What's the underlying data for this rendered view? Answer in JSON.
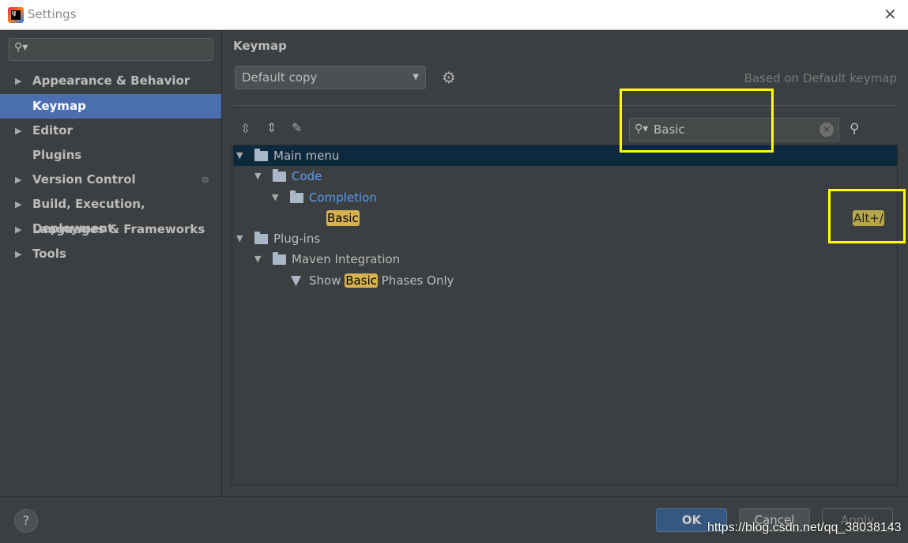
{
  "window": {
    "title": "Settings",
    "close": "✕"
  },
  "sidebar": {
    "search_placeholder": "",
    "items": [
      {
        "label": "Appearance & Behavior",
        "expandable": true
      },
      {
        "label": "Keymap",
        "selected": true
      },
      {
        "label": "Editor",
        "expandable": true
      },
      {
        "label": "Plugins"
      },
      {
        "label": "Version Control",
        "expandable": true
      },
      {
        "label": "Build, Execution, Deployment",
        "expandable": true
      },
      {
        "label": "Languages & Frameworks",
        "expandable": true
      },
      {
        "label": "Tools",
        "expandable": true
      }
    ]
  },
  "main": {
    "title": "Keymap",
    "keymap_select": "Default copy",
    "based_on": "Based on Default keymap",
    "search_value": "Basic",
    "tree": {
      "main_menu": "Main menu",
      "code": "Code",
      "completion": "Completion",
      "basic": "Basic",
      "shortcut": "Alt+/",
      "plugins": "Plug-ins",
      "maven": "Maven Integration",
      "show": "Show",
      "show_hl": "Basic",
      "show_rest": "Phases Only"
    }
  },
  "footer": {
    "help": "?",
    "ok": "OK",
    "cancel": "Cancel",
    "apply": "Apply",
    "watermark": "https://blog.csdn.net/qq_38038143"
  },
  "colors": {
    "selection": "#4b6eaf",
    "highlight": "#d5b14f",
    "annotation": "#ffff00",
    "link": "#589df6"
  }
}
